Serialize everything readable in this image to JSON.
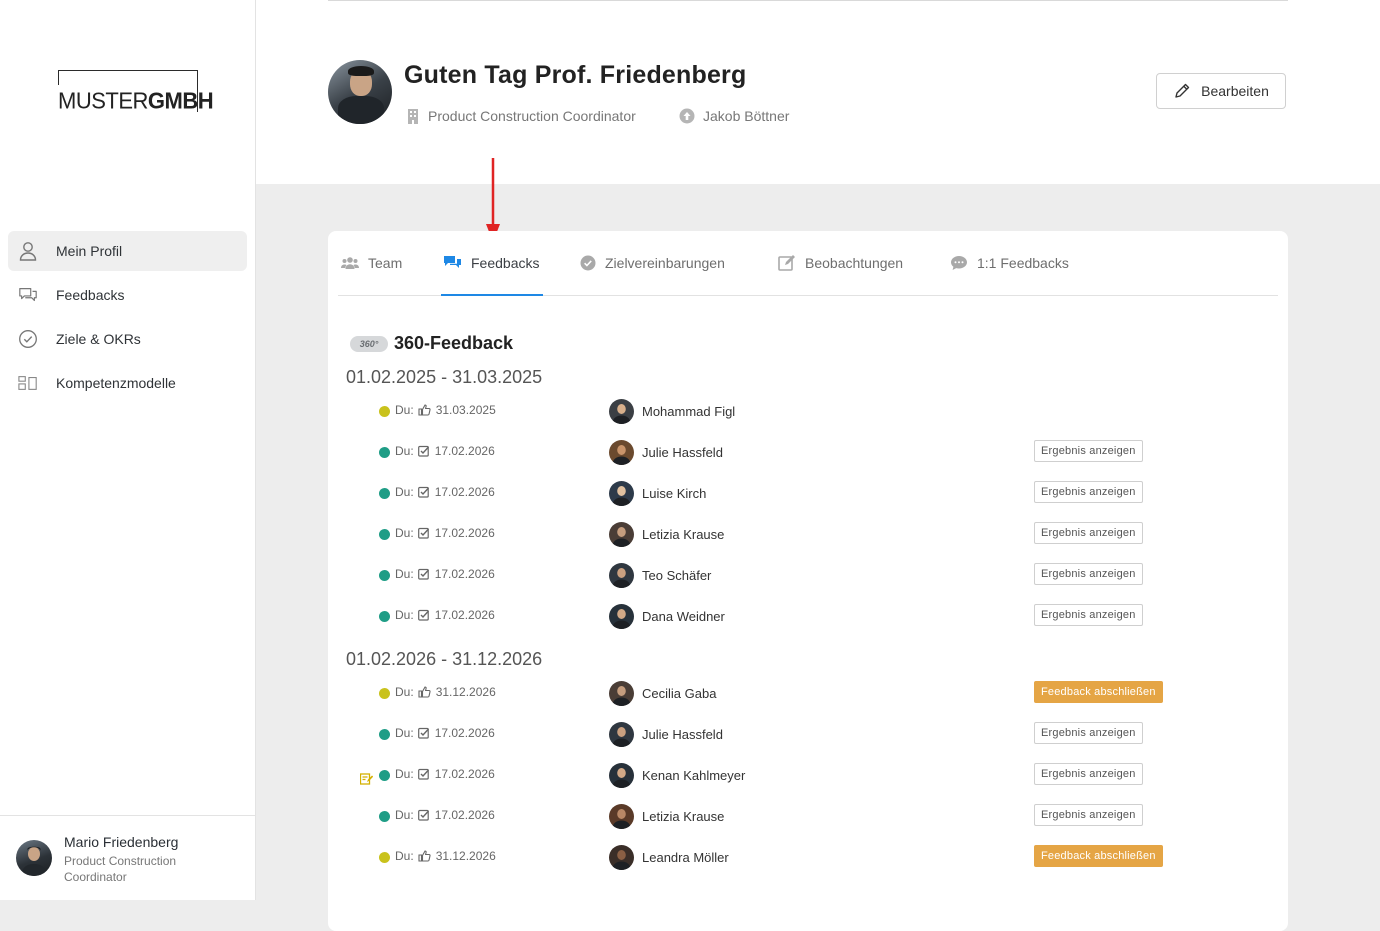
{
  "logo": {
    "part1": "MUSTER",
    "part2": "GMBH"
  },
  "nav": [
    {
      "label": "Mein Profil",
      "icon": "user-icon",
      "active": true
    },
    {
      "label": "Feedbacks",
      "icon": "chat-bubbles-icon"
    },
    {
      "label": "Ziele & OKRs",
      "icon": "check-circle-icon"
    },
    {
      "label": "Kompetenzmodelle",
      "icon": "blocks-icon"
    }
  ],
  "footer_user": {
    "name": "Mario Friedenberg",
    "role": "Product Construction Coordinator"
  },
  "header": {
    "greeting": "Guten Tag Prof. Friedenberg",
    "position": "Product Construction Coordinator",
    "manager": "Jakob Böttner",
    "edit_label": "Bearbeiten"
  },
  "tabs": [
    {
      "label": "Team",
      "icon": "team-icon"
    },
    {
      "label": "Feedbacks",
      "icon": "feedback-bubbles-icon",
      "active": true
    },
    {
      "label": "Zielvereinbarungen",
      "icon": "check-circle-icon"
    },
    {
      "label": "Beobachtungen",
      "icon": "edit-note-icon"
    },
    {
      "label": "1:1 Feedbacks",
      "icon": "chat-dots-icon"
    }
  ],
  "section": {
    "badge": "360°",
    "title": "360-Feedback",
    "periods": [
      {
        "label": "01.02.2025 - 31.03.2025",
        "rows": [
          {
            "status": "yellow",
            "du": "Du:",
            "action": "pointer",
            "date": "31.03.2025",
            "name": "Mohammad Figl",
            "button": ""
          },
          {
            "status": "green",
            "du": "Du:",
            "action": "check",
            "date": "17.02.2026",
            "name": "Julie Hassfeld",
            "button": "Ergebnis anzeigen"
          },
          {
            "status": "green",
            "du": "Du:",
            "action": "check",
            "date": "17.02.2026",
            "name": "Luise Kirch",
            "button": "Ergebnis anzeigen"
          },
          {
            "status": "green",
            "du": "Du:",
            "action": "check",
            "date": "17.02.2026",
            "name": "Letizia Krause",
            "button": "Ergebnis anzeigen"
          },
          {
            "status": "green",
            "du": "Du:",
            "action": "check",
            "date": "17.02.2026",
            "name": "Teo Schäfer",
            "button": "Ergebnis anzeigen"
          },
          {
            "status": "green",
            "du": "Du:",
            "action": "check",
            "date": "17.02.2026",
            "name": "Dana Weidner",
            "button": "Ergebnis anzeigen"
          }
        ]
      },
      {
        "label": "01.02.2026 - 31.12.2026",
        "rows": [
          {
            "status": "yellow",
            "du": "Du:",
            "action": "pointer",
            "date": "31.12.2026",
            "name": "Cecilia Gaba",
            "button": "Feedback abschließen",
            "button_type": "finish"
          },
          {
            "status": "green",
            "du": "Du:",
            "action": "check",
            "date": "17.02.2026",
            "name": "Julie Hassfeld",
            "button": "Ergebnis anzeigen"
          },
          {
            "status": "green",
            "du": "Du:",
            "action": "check",
            "date": "17.02.2026",
            "name": "Kenan Kahlmeyer",
            "button": "Ergebnis anzeigen",
            "flag": true
          },
          {
            "status": "green",
            "du": "Du:",
            "action": "check",
            "date": "17.02.2026",
            "name": "Letizia Krause",
            "button": "Ergebnis anzeigen"
          },
          {
            "status": "yellow",
            "du": "Du:",
            "action": "pointer",
            "date": "31.12.2026",
            "name": "Leandra Möller",
            "button": "Feedback abschließen",
            "button_type": "finish"
          }
        ]
      }
    ]
  },
  "colors": {
    "accent": "#1e88e5",
    "finish_button": "#e5a545",
    "status_green": "#1f9d86",
    "status_yellow": "#c9c21c",
    "arrow": "#e02424"
  }
}
